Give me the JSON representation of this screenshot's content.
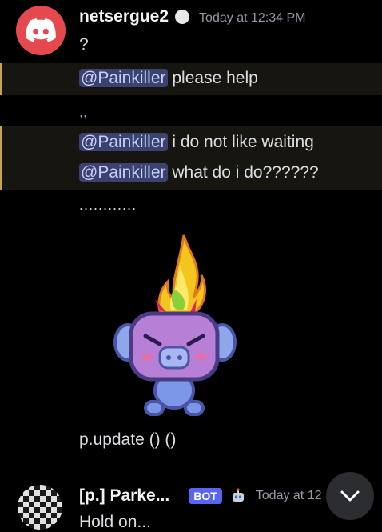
{
  "message1": {
    "username": "netsergue2",
    "timestamp": "Today at 12:34 PM",
    "lines": {
      "l1": "?",
      "l2_mention": "@Painkiller",
      "l2_text": " please help",
      "l3": ",,",
      "l4_mention": "@Painkiller",
      "l4_text": " i do not like waiting",
      "l5_mention": "@Painkiller",
      "l5_text": " what do i do??????",
      "l6": "............",
      "l7": "p.update () ()"
    },
    "sticker": "angry-wumpus-fire-sticker"
  },
  "message2": {
    "username": "[p.] Parke...",
    "badge": "BOT",
    "timestamp": "Today at 12",
    "text": "Hold on..."
  },
  "colors": {
    "background": "#000000",
    "discord_red": "#e5484d",
    "mention_bg": "#3c4270",
    "mention_text": "#c9cdfb",
    "highlight_bar": "#c9a24a",
    "bot_badge": "#5865f2"
  },
  "icons": [
    "discord-logo-icon",
    "status-dot-icon",
    "robot-icon",
    "chevron-down-icon"
  ]
}
